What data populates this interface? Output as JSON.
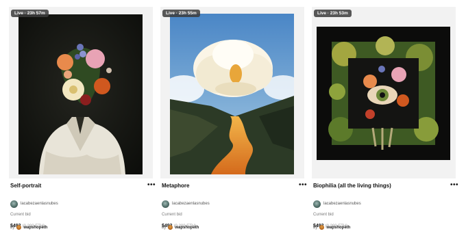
{
  "cards": [
    {
      "live_badge": "Live · 23h 57m",
      "title": "Self-portrait",
      "more": "•••",
      "artist": "lacabezaenlasnubes",
      "current_bid_label": "Current bid",
      "bid_usd": "$493",
      "bid_eth": "(0.200 ETH)",
      "by_label": "by",
      "bidder": "wapshopeth"
    },
    {
      "live_badge": "Live · 23h 55m",
      "title": "Metaphore",
      "more": "•••",
      "artist": "lacabezaenlasnubes",
      "current_bid_label": "Current bid",
      "bid_usd": "$493",
      "bid_eth": "(0.200 ETH)",
      "by_label": "by",
      "bidder": "wapshopeth"
    },
    {
      "live_badge": "Live · 23h 53m",
      "title": "Biophilia (all the living things)",
      "more": "•••",
      "artist": "lacabezaenlasnubes",
      "current_bid_label": "Current bid",
      "bid_usd": "$493",
      "bid_eth": "(0.200 ETH)",
      "by_label": "by",
      "bidder": "wapshopeth"
    }
  ],
  "colors": {
    "background": "#ffffff",
    "card_frame": "#f2f2f2",
    "badge_bg": "#3c3c3c",
    "text_primary": "#111111",
    "text_muted": "#777777"
  },
  "icons": {
    "more": "more-dots-icon",
    "artist_avatar": "artist-avatar",
    "bidder_avatar": "bidder-avatar"
  }
}
